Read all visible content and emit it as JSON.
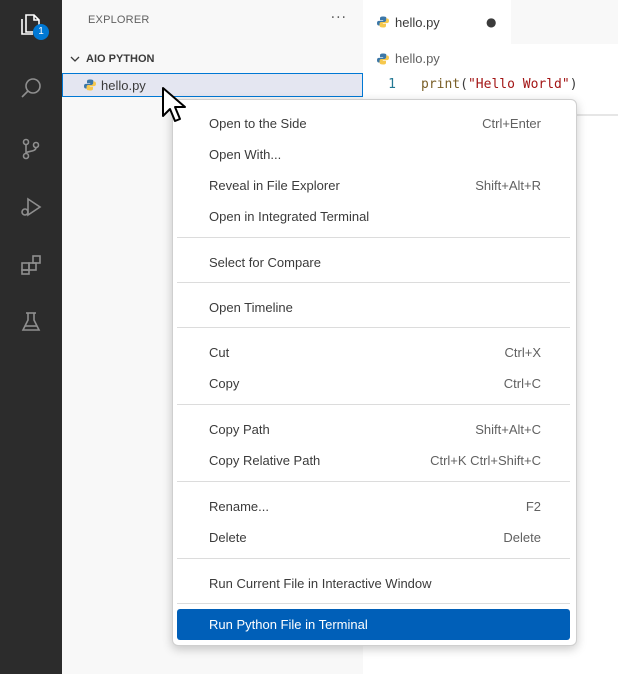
{
  "activity_bar": {
    "explorer_badge": "1",
    "icons": [
      "explorer-icon",
      "search-icon",
      "source-control-icon",
      "run-debug-icon",
      "extensions-icon",
      "testing-icon"
    ]
  },
  "sidebar": {
    "title": "EXPLORER",
    "more": "···",
    "folder": "AIO PYTHON",
    "file": "hello.py"
  },
  "editor": {
    "tab_label": "hello.py",
    "dirty_indicator": "●",
    "breadcrumb": "hello.py",
    "line_number": "1",
    "code_fn": "print",
    "code_open": "(",
    "code_string": "\"Hello World\"",
    "code_close": ")"
  },
  "context_menu": {
    "items": [
      {
        "label": "Open to the Side",
        "shortcut": "Ctrl+Enter"
      },
      {
        "label": "Open With...",
        "shortcut": ""
      },
      {
        "label": "Reveal in File Explorer",
        "shortcut": "Shift+Alt+R"
      },
      {
        "label": "Open in Integrated Terminal",
        "shortcut": ""
      },
      {
        "label": "Select for Compare",
        "shortcut": ""
      },
      {
        "label": "Open Timeline",
        "shortcut": ""
      },
      {
        "label": "Cut",
        "shortcut": "Ctrl+X"
      },
      {
        "label": "Copy",
        "shortcut": "Ctrl+C"
      },
      {
        "label": "Copy Path",
        "shortcut": "Shift+Alt+C"
      },
      {
        "label": "Copy Relative Path",
        "shortcut": "Ctrl+K Ctrl+Shift+C"
      },
      {
        "label": "Rename...",
        "shortcut": "F2"
      },
      {
        "label": "Delete",
        "shortcut": "Delete"
      },
      {
        "label": "Run Current File in Interactive Window",
        "shortcut": ""
      },
      {
        "label": "Run Python File in Terminal",
        "shortcut": ""
      }
    ],
    "selected_item": "Run Python File in Terminal"
  },
  "colors": {
    "activity_bar": "#2c2c2c",
    "accent": "#0078d4",
    "selected_menu": "#005fb8",
    "python_blue": "#3b77a8",
    "python_yellow": "#f6c84d"
  }
}
